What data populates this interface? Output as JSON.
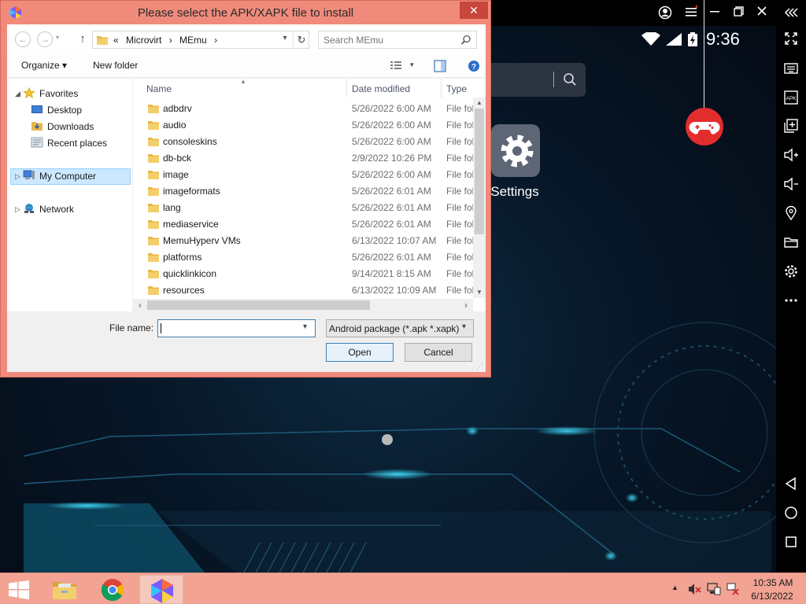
{
  "dialog": {
    "title": "Please select the APK/XAPK file to install",
    "close_label": "✕",
    "address": {
      "crumbs": [
        "«",
        "Microvirt",
        "›",
        "MEmu",
        "›"
      ]
    },
    "search_placeholder": "Search MEmu",
    "toolbar": {
      "organize": "Organize ▾",
      "new_folder": "New folder"
    },
    "nav": {
      "favorites": "Favorites",
      "desktop": "Desktop",
      "downloads": "Downloads",
      "recent_places": "Recent places",
      "my_computer": "My Computer",
      "network": "Network"
    },
    "columns": {
      "name": "Name",
      "date_modified": "Date modified",
      "type": "Type"
    },
    "files": [
      {
        "name": "adbdrv",
        "date": "5/26/2022 6:00 AM",
        "type": "File folder"
      },
      {
        "name": "audio",
        "date": "5/26/2022 6:00 AM",
        "type": "File folder"
      },
      {
        "name": "consoleskins",
        "date": "5/26/2022 6:00 AM",
        "type": "File folder"
      },
      {
        "name": "db-bck",
        "date": "2/9/2022 10:26 PM",
        "type": "File folder"
      },
      {
        "name": "image",
        "date": "5/26/2022 6:00 AM",
        "type": "File folder"
      },
      {
        "name": "imageformats",
        "date": "5/26/2022 6:01 AM",
        "type": "File folder"
      },
      {
        "name": "lang",
        "date": "5/26/2022 6:01 AM",
        "type": "File folder"
      },
      {
        "name": "mediaservice",
        "date": "5/26/2022 6:01 AM",
        "type": "File folder"
      },
      {
        "name": "MemuHyperv VMs",
        "date": "6/13/2022 10:07 AM",
        "type": "File folder"
      },
      {
        "name": "platforms",
        "date": "5/26/2022 6:01 AM",
        "type": "File folder"
      },
      {
        "name": "quicklinkicon",
        "date": "9/14/2021 8:15 AM",
        "type": "File folder"
      },
      {
        "name": "resources",
        "date": "6/13/2022 10:09 AM",
        "type": "File folder"
      }
    ],
    "file_name_label": "File name:",
    "file_name_value": "",
    "file_type": "Android package (*.apk *.xapk)",
    "open_label": "Open",
    "cancel_label": "Cancel"
  },
  "emulator": {
    "status_time": "9:36",
    "settings_label": "Settings",
    "sidebar_apk": "APK"
  },
  "taskbar": {
    "time": "10:35 AM",
    "date": "6/13/2022"
  },
  "colors": {
    "dialog_frame": "#f08b7c",
    "close_button": "#c9463a",
    "taskbar": "#f2a394",
    "selection": "#cce8ff",
    "game_button": "#e32d2d",
    "folder": "#e8b84a"
  }
}
